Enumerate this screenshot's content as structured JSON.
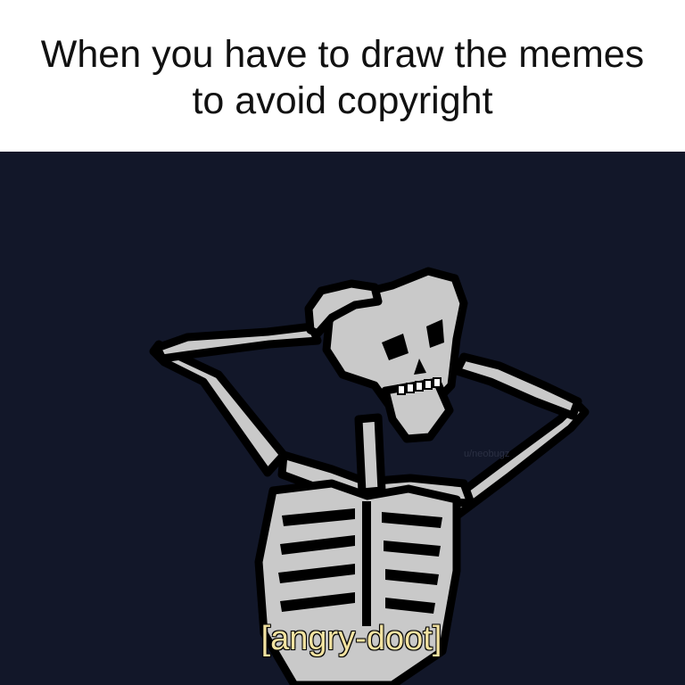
{
  "caption": {
    "line1": "When you have to draw the memes",
    "line2": "to avoid copyright"
  },
  "art": {
    "subtitle": "[angry-doot]",
    "watermark": "u/neobugz",
    "subject": "skeleton-drawing",
    "colors": {
      "background": "#121729",
      "bone": "#c9c9c9",
      "outline": "#000000",
      "subtitle_text": "#f2e2a0"
    }
  }
}
